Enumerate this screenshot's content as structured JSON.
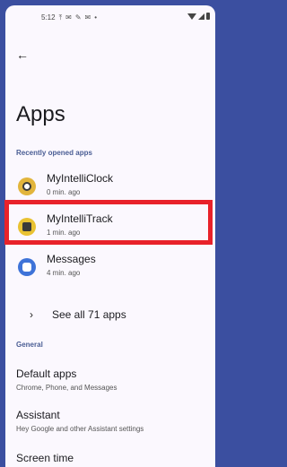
{
  "status_bar": {
    "time": "5:12",
    "icons": [
      "upload-icon",
      "gmail-icon",
      "wrench-icon",
      "gmail-icon",
      "dot-icon"
    ],
    "right_icons": [
      "wifi-icon",
      "signal-icon",
      "battery-icon"
    ]
  },
  "header": {
    "back_icon": "arrow-left-icon",
    "title": "Apps"
  },
  "recent": {
    "section_label": "Recently opened apps",
    "apps": [
      {
        "name": "MyIntelliClock",
        "time": "0 min. ago",
        "icon": "clock-app-icon",
        "color": "#e2b53c"
      },
      {
        "name": "MyIntelliTrack",
        "time": "1 min. ago",
        "icon": "track-app-icon",
        "color": "#e9c232"
      },
      {
        "name": "Messages",
        "time": "4 min. ago",
        "icon": "messages-app-icon",
        "color": "#3e73d8"
      }
    ],
    "see_all": "See all 71 apps"
  },
  "general": {
    "section_label": "General",
    "items": [
      {
        "title": "Default apps",
        "subtitle": "Chrome, Phone, and Messages"
      },
      {
        "title": "Assistant",
        "subtitle": "Hey Google and other Assistant settings"
      },
      {
        "title": "Screen time",
        "subtitle": ""
      }
    ]
  },
  "colors": {
    "frame": "#3b4fa0",
    "highlight": "#e8222a",
    "section_label": "#4a5d94"
  }
}
